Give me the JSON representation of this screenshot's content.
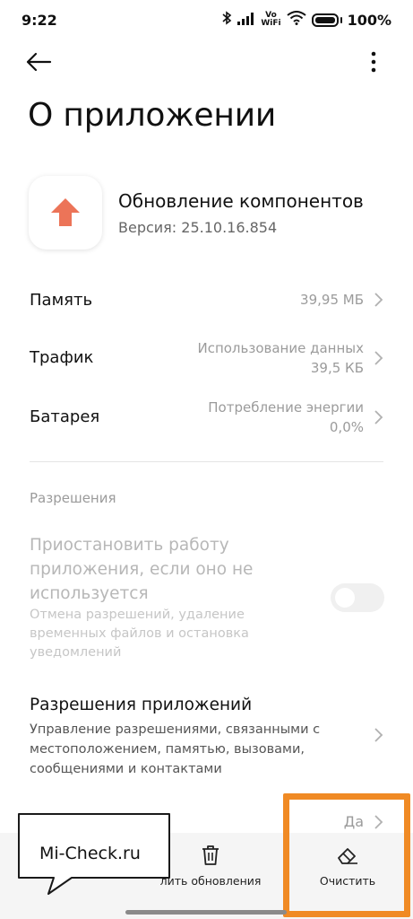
{
  "status_bar": {
    "time": "9:22",
    "volte_top": "Vo",
    "volte_bottom": "WiFi",
    "battery_percent": "100%"
  },
  "header": {
    "title": "О приложении"
  },
  "app": {
    "name": "Обновление компонентов",
    "version": "Версия: 25.10.16.854",
    "icon": "arrow-up-icon",
    "icon_color": "#ec7458"
  },
  "rows": [
    {
      "label": "Память",
      "value": [
        "39,95 МБ"
      ]
    },
    {
      "label": "Трафик",
      "value": [
        "Использование данных",
        "39,5 КБ"
      ]
    },
    {
      "label": "Батарея",
      "value": [
        "Потребление энергии",
        "0,0%"
      ]
    }
  ],
  "permissions": {
    "section_title": "Разрешения",
    "pause": {
      "title": "Приостановить работу приложения, если оно не используется",
      "description": "Отмена разрешений, удаление временных файлов и остановка уведомлений",
      "enabled": false
    },
    "app_permissions": {
      "title": "Разрешения приложений",
      "description": "Управление разрешениями, связанными с местоположением, памятью, вызовами, сообщениями и контактами"
    },
    "partial_value": "Да"
  },
  "bottom_actions": {
    "uninstall_updates": "лить обновления",
    "clear": "Очистить"
  },
  "watermark": "Mi-Check.ru",
  "colors": {
    "highlight": "#f08a24",
    "accent_icon": "#ec7458"
  }
}
